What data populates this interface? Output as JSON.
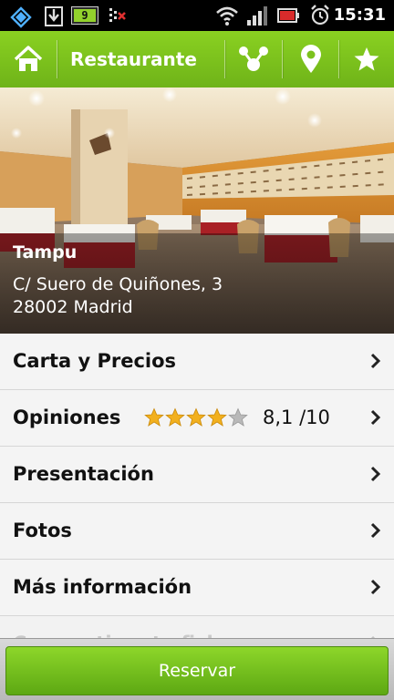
{
  "status_bar": {
    "time": "15:31",
    "battery_level": "9",
    "icons": [
      "notification-icon",
      "download-icon",
      "battery-icon",
      "signal-warning-icon",
      "wifi-icon",
      "cell-signal-icon",
      "phone-battery-icon",
      "alarm-icon"
    ]
  },
  "action_bar": {
    "title": "Restaurante",
    "icons": [
      "home-icon",
      "share-icon",
      "location-pin-icon",
      "favorite-star-icon"
    ]
  },
  "restaurant": {
    "name": "Tampu",
    "address_line1": "C/ Suero de Quiñones, 3",
    "address_line2": "28002 Madrid"
  },
  "menu": {
    "items": [
      {
        "label": "Carta y Precios"
      },
      {
        "label": "Opiniones",
        "rating_stars": 4,
        "rating_max_stars": 5,
        "score": "8,1 /10"
      },
      {
        "label": "Presentación"
      },
      {
        "label": "Fotos"
      },
      {
        "label": "Más información"
      },
      {
        "label": "Compartir esta ficha"
      }
    ]
  },
  "reserve_button": {
    "label": "Reservar"
  },
  "colors": {
    "accent_green": "#7cc21d",
    "star_gold": "#f2b01e",
    "star_empty": "#b9b9b9",
    "list_background": "#f4f4f4"
  }
}
